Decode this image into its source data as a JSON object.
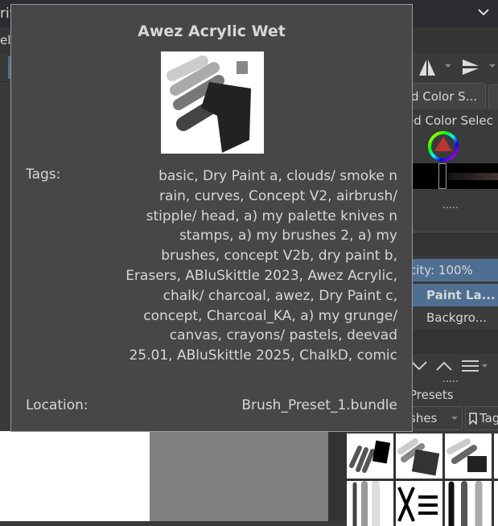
{
  "window": {
    "title_fragment": "rit",
    "menu_fragment": "elp"
  },
  "dock": {
    "color_tab_label": "d Color S...",
    "color_selector_title": "ed Color Selec",
    "opacity_label": "city: 100%",
    "layers": [
      {
        "name": "Paint La...",
        "selected": true
      },
      {
        "name": "Backgro...",
        "selected": false
      }
    ],
    "presets_title": "Presets",
    "brush_filter": "shes",
    "tag_button": "Tag"
  },
  "tooltip": {
    "title": "Awez Acrylic Wet",
    "tags_label": "Tags:",
    "tags": "basic, Dry Paint a, clouds/ smoke n rain, curves, Concept V2, airbrush/ stipple/ head, a) my palette knives n stamps, a) my brushes 2, a) my brushes, concept V2b, dry paint b, Erasers, ABluSkittle 2023, Awez Acrylic, chalk/ charcoal, awez, Dry Paint c, concept, Charcoal_KA, a) my grunge/ canvas, crayons/ pastels, deevad 25.01, ABluSkittle 2025, ChalkD, comic",
    "location_label": "Location:",
    "location": "Brush_Preset_1.bundle"
  },
  "colors": {
    "selection": "#4e6f91",
    "tooltip_bg": "#474747"
  }
}
